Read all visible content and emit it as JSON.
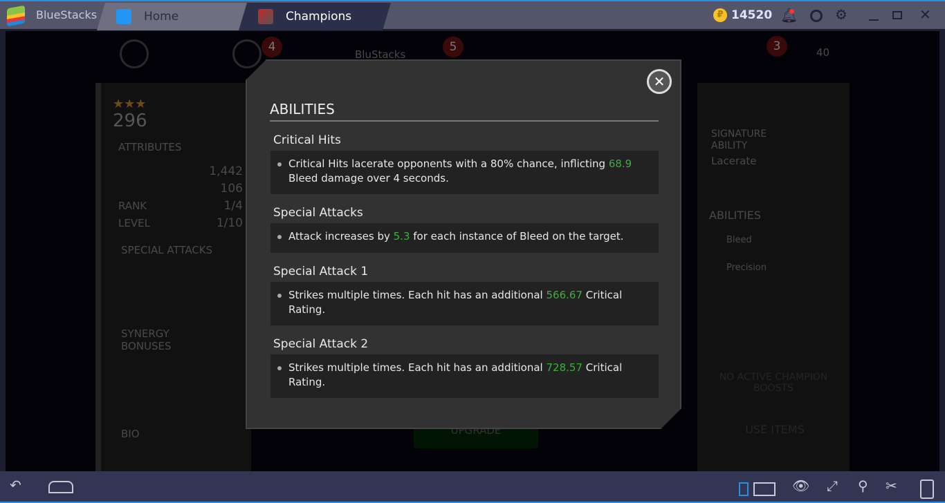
{
  "window": {
    "app_name": "BlueStacks",
    "tabs": [
      {
        "label": "Home"
      },
      {
        "label": "Champions"
      }
    ],
    "coins": "14520",
    "accent": "#2a8ee0"
  },
  "game_bg": {
    "badges": [
      "4",
      "5",
      "3"
    ],
    "player": "BluStacks",
    "count": "40",
    "upgrade": "UPGRADE"
  },
  "left_panel": {
    "stars": "★★★",
    "rating": "296",
    "attributes_title": "ATTRIBUTES",
    "health": "1,442",
    "attack": "106",
    "rank_label": "RANK",
    "rank": "1/4",
    "level_label": "LEVEL",
    "level": "1/10",
    "special_title": "SPECIAL ATTACKS",
    "synergy_title": "SYNERGY BONUSES",
    "bio_title": "BIO"
  },
  "right_panel": {
    "signature_title": "SIGNATURE ABILITY",
    "signature_name": "Lacerate",
    "abilities_title": "ABILITIES",
    "abilities": [
      "Bleed",
      "Precision"
    ],
    "boosts": "NO ACTIVE CHAMPION BOOSTS",
    "use_items": "USE ITEMS"
  },
  "modal": {
    "title": "ABILITIES",
    "sections": [
      {
        "heading": "Critical Hits",
        "pre": "Critical Hits lacerate opponents with a 80% chance, inflicting ",
        "value": "68.9",
        "post": " Bleed damage over 4 seconds."
      },
      {
        "heading": "Special Attacks",
        "pre": "Attack increases by ",
        "value": "5.3",
        "post": " for each instance of Bleed on the target."
      },
      {
        "heading": "Special Attack 1",
        "pre": "Strikes multiple times. Each hit has an additional ",
        "value": "566.67",
        "post": " Critical Rating."
      },
      {
        "heading": "Special Attack 2",
        "pre": "Strikes multiple times. Each hit has an additional ",
        "value": "728.57",
        "post": " Critical Rating."
      }
    ],
    "highlight_color": "#3fae3f"
  }
}
